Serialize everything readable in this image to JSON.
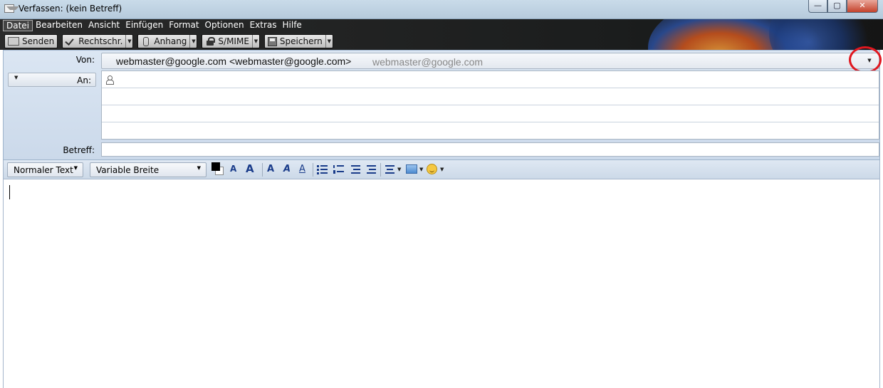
{
  "window": {
    "title": "Verfassen: (kein Betreff)",
    "controls": [
      "minimize",
      "maximize",
      "close"
    ]
  },
  "menubar": {
    "items": [
      "Datei",
      "Bearbeiten",
      "Ansicht",
      "Einfügen",
      "Format",
      "Optionen",
      "Extras",
      "Hilfe"
    ],
    "active": "Datei"
  },
  "toolbar": {
    "send_label": "Senden",
    "spell_label": "Rechtschr.",
    "attach_label": "Anhang",
    "smime_label": "S/MIME",
    "save_label": "Speichern"
  },
  "header": {
    "from_label": "Von:",
    "from_value": "webmaster@google.com <webmaster@google.com>",
    "from_hint": "webmaster@google.com",
    "to_type": "An:",
    "recipient_rows": 4,
    "subject_label": "Betreff:",
    "subject_value": ""
  },
  "format_toolbar": {
    "paragraph_style": "Normaler Text",
    "font_family": "Variable Breite",
    "text_color": "#000000",
    "background_color": "#ffffff"
  },
  "icons": {
    "smaller": "A",
    "larger": "A",
    "bold": "A",
    "italic": "A",
    "underline": "A"
  },
  "colors": {
    "highlight_circle": "#e0171f",
    "header_panel": "#d5e1ef",
    "format_icon_blue": "#1a3c8a"
  }
}
